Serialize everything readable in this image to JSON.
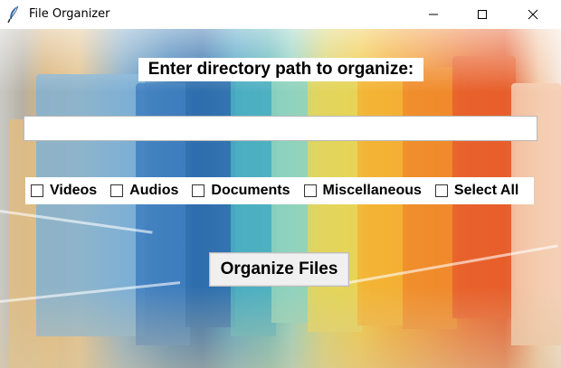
{
  "window": {
    "title": "File Organizer",
    "app_icon": "feather-icon",
    "controls": {
      "minimize_icon": "minimize-icon",
      "maximize_icon": "maximize-icon",
      "close_icon": "close-icon"
    }
  },
  "main": {
    "prompt": "Enter directory path to organize:",
    "path_input": {
      "value": "",
      "placeholder": ""
    },
    "options": [
      {
        "label": "Videos",
        "checked": false
      },
      {
        "label": "Audios",
        "checked": false
      },
      {
        "label": "Documents",
        "checked": false
      },
      {
        "label": "Miscellaneous",
        "checked": false
      },
      {
        "label": "Select All",
        "checked": false
      }
    ],
    "organize_button": "Organize Files"
  }
}
